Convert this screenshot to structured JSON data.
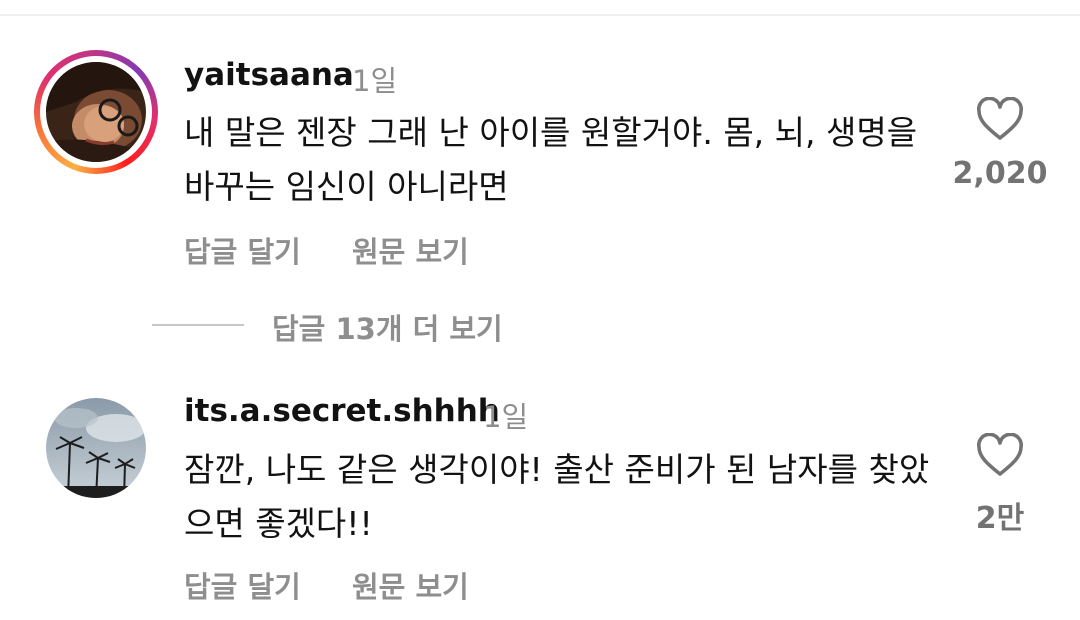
{
  "comments": [
    {
      "username": "yaitsaana",
      "time": "1일",
      "text": "내 말은 젠장 그래 난 아이를 원할거야. 몸, 뇌, 생명을 바꾸는 임신이 아니라면",
      "reply_label": "답글 달기",
      "translate_label": "원문 보기",
      "likes": "2,020",
      "has_story_ring": true
    },
    {
      "username": "its.a.secret.shhhh",
      "time": "1일",
      "text": "잠깐, 나도 같은 생각이야! 출산 준비가 된 남자를 찾았으면 좋겠다!!",
      "reply_label": "답글 달기",
      "translate_label": "원문 보기",
      "likes": "2만",
      "has_story_ring": false
    }
  ],
  "view_replies": "답글 13개 더 보기",
  "colors": {
    "primary_text": "#121212",
    "secondary_text": "#8e8e8e",
    "like_count": "#737373"
  },
  "icons": [
    "heart-outline-icon"
  ]
}
